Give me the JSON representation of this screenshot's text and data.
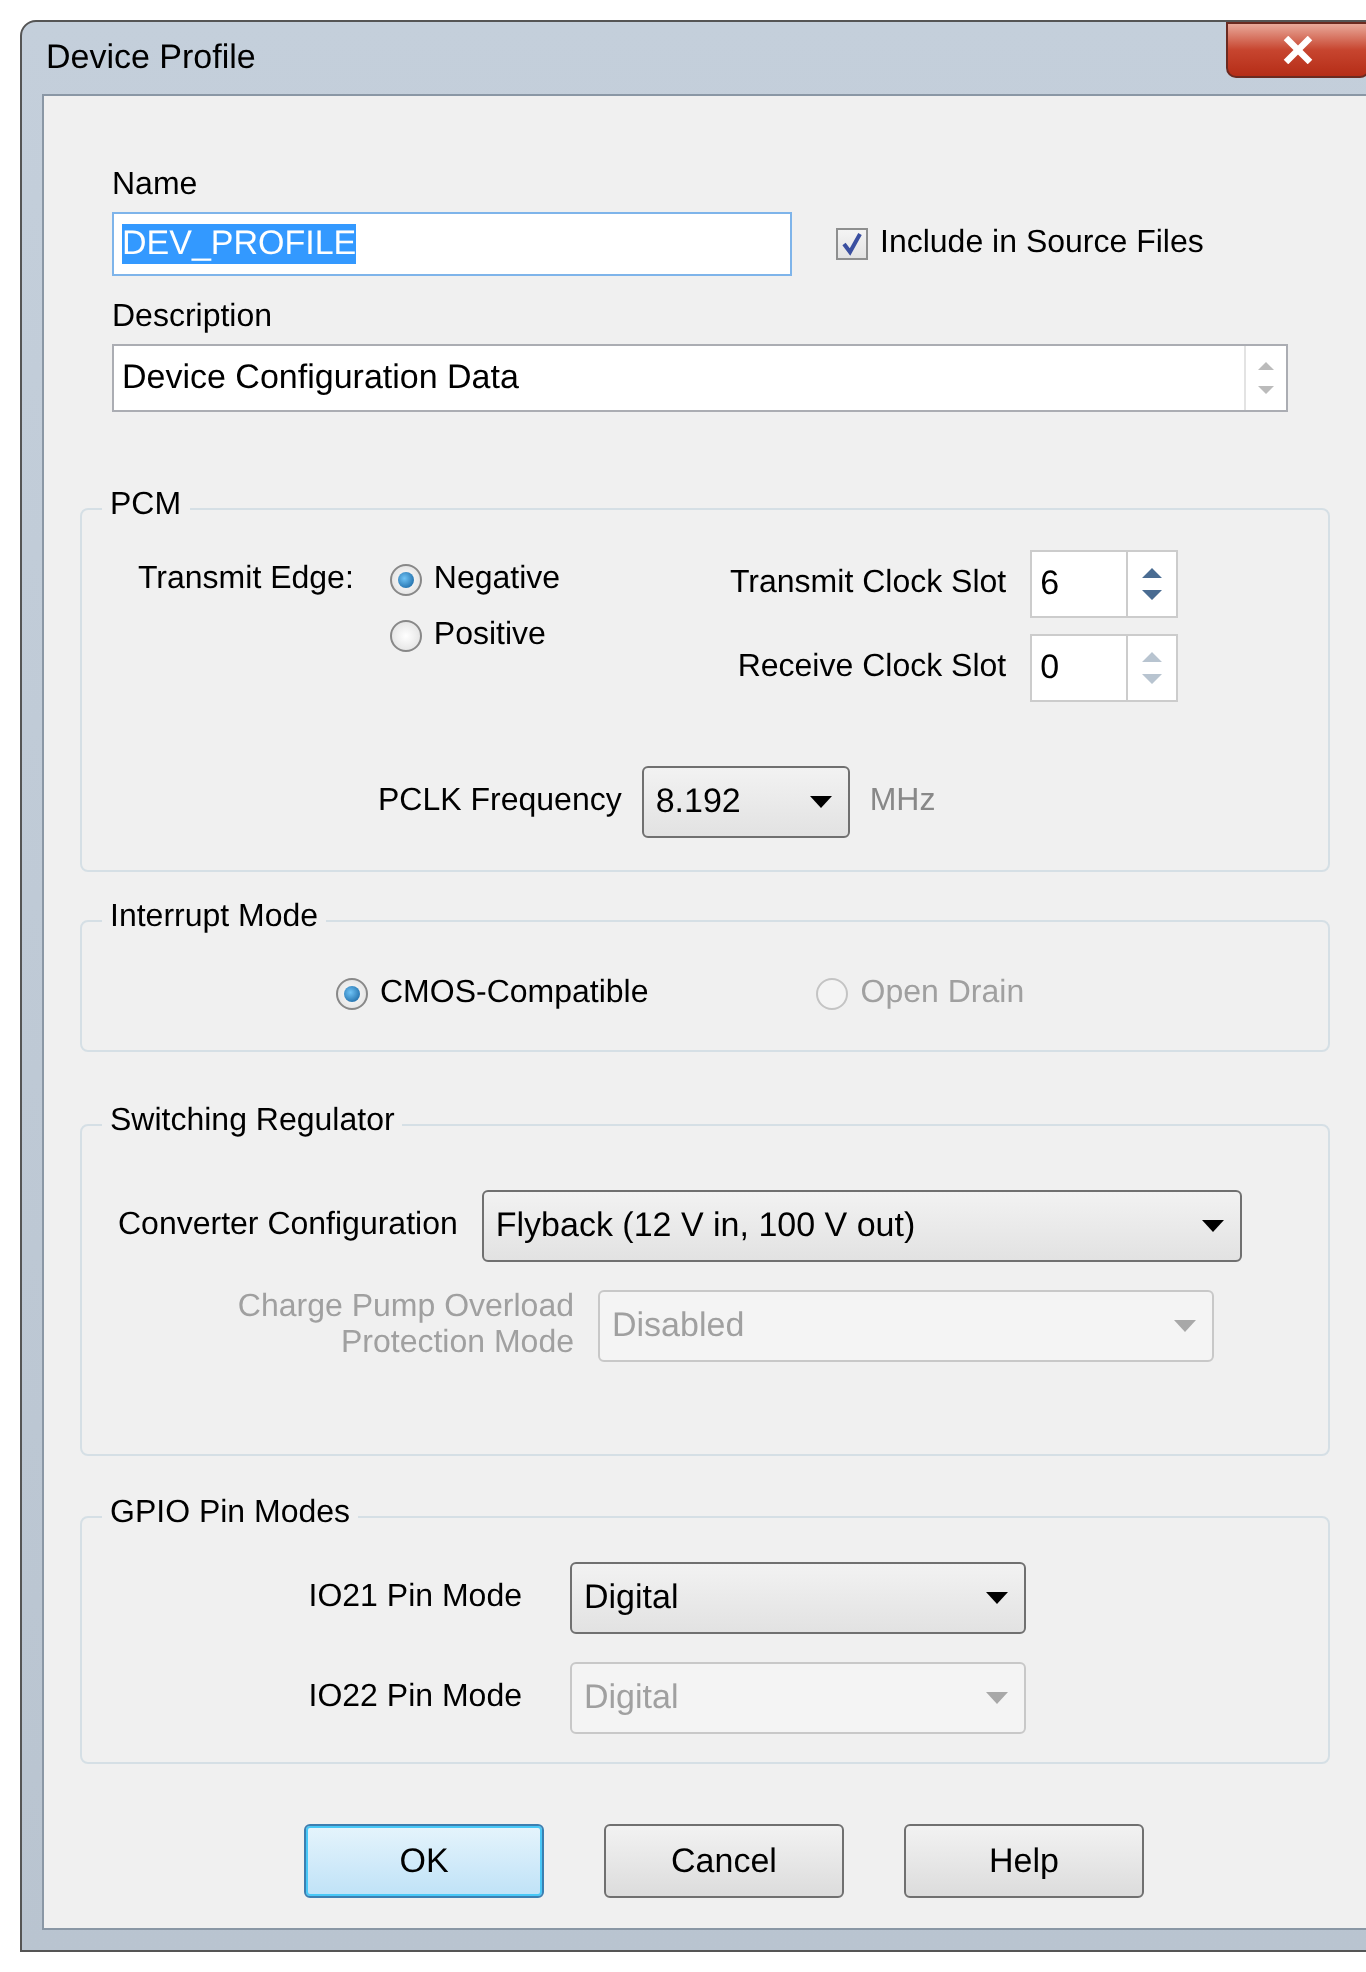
{
  "window": {
    "title": "Device Profile"
  },
  "name": {
    "label": "Name",
    "value": "DEV_PROFILE",
    "text_selected": true
  },
  "include_in_source": {
    "label": "Include in Source Files",
    "checked": true
  },
  "description": {
    "label": "Description",
    "value": "Device Configuration Data"
  },
  "pcm": {
    "title": "PCM",
    "transmit_edge": {
      "label": "Transmit Edge:",
      "options": [
        {
          "label": "Negative",
          "selected": true,
          "disabled": false
        },
        {
          "label": "Positive",
          "selected": false,
          "disabled": false
        }
      ]
    },
    "spinners": [
      {
        "label": "Transmit Clock Slot",
        "value": "6",
        "disabled": false
      },
      {
        "label": "Receive Clock Slot",
        "value": "0",
        "disabled": true
      }
    ],
    "pclk": {
      "label": "PCLK Frequency",
      "value": "8.192",
      "unit": "MHz"
    }
  },
  "interrupt_mode": {
    "title": "Interrupt Mode",
    "options": [
      {
        "label": "CMOS-Compatible",
        "selected": true,
        "disabled": false
      },
      {
        "label": "Open Drain",
        "selected": false,
        "disabled": true
      }
    ]
  },
  "switching_regulator": {
    "title": "Switching Regulator",
    "fields": [
      {
        "label": "Converter Configuration",
        "value": "Flyback (12 V in, 100 V out)",
        "disabled": false
      },
      {
        "label": "Charge Pump Overload Protection Mode",
        "value": "Disabled",
        "disabled": true
      }
    ]
  },
  "gpio_pin_modes": {
    "title": "GPIO Pin Modes",
    "fields": [
      {
        "label": "IO21 Pin Mode",
        "value": "Digital",
        "disabled": false
      },
      {
        "label": "IO22 Pin Mode",
        "value": "Digital",
        "disabled": true
      }
    ]
  },
  "buttons": [
    {
      "label": "OK",
      "default": true
    },
    {
      "label": "Cancel",
      "default": false
    },
    {
      "label": "Help",
      "default": false
    }
  ]
}
